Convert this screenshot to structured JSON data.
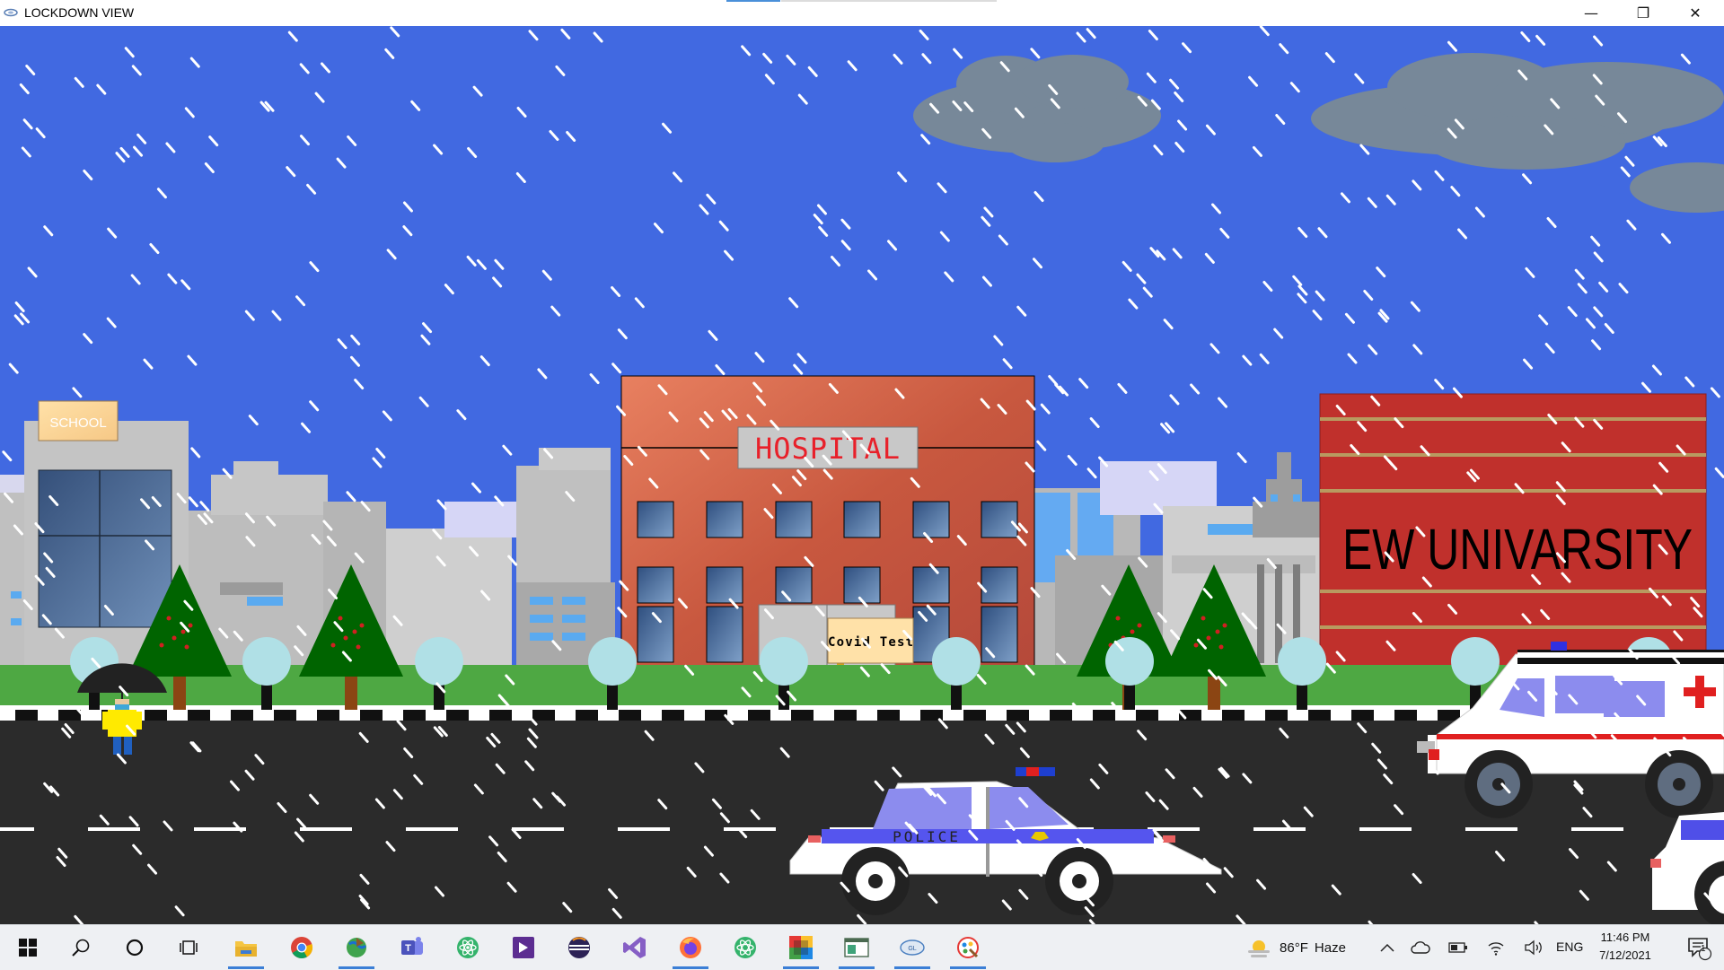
{
  "window": {
    "title": "LOCKDOWN VIEW",
    "controls": {
      "minimize": "—",
      "maximize": "❐",
      "close": "✕"
    }
  },
  "scene": {
    "colors": {
      "sky": "#4169e1",
      "cloud": "#778899",
      "grass": "#4ea843",
      "road": "#2b2b2b",
      "hospital": "#c8583f",
      "university": "#c0302c"
    },
    "signs": {
      "school": "SCHOOL",
      "hospital": "HOSPITAL",
      "covid_test": "Covid Test",
      "university": "EW UNIVARSITY",
      "police": "POLICE"
    }
  },
  "taskbar": {
    "apps": [
      {
        "icon": "windows-start-icon"
      },
      {
        "icon": "search-icon"
      },
      {
        "icon": "cortana-icon"
      },
      {
        "icon": "task-view-icon"
      },
      {
        "icon": "file-explorer-icon",
        "active": true
      },
      {
        "icon": "chrome-icon"
      },
      {
        "icon": "globe-app-icon",
        "active": true
      },
      {
        "icon": "teams-icon"
      },
      {
        "icon": "atom-icon"
      },
      {
        "icon": "media-app-icon"
      },
      {
        "icon": "eclipse-icon"
      },
      {
        "icon": "visual-studio-icon"
      },
      {
        "icon": "firefox-icon",
        "active": true
      },
      {
        "icon": "atom-green-icon"
      },
      {
        "icon": "multicolor-app-icon",
        "active": true
      },
      {
        "icon": "window-app-icon",
        "active": true
      },
      {
        "icon": "opengl-app-icon",
        "active": true
      },
      {
        "icon": "paint-app-icon",
        "active": true
      }
    ],
    "weather": {
      "temp": "86°F",
      "condition": "Haze"
    },
    "tray": {
      "language": "ENG"
    },
    "clock": {
      "time": "11:46 PM",
      "date": "7/12/2021"
    },
    "notifications": {
      "count": "1"
    }
  }
}
